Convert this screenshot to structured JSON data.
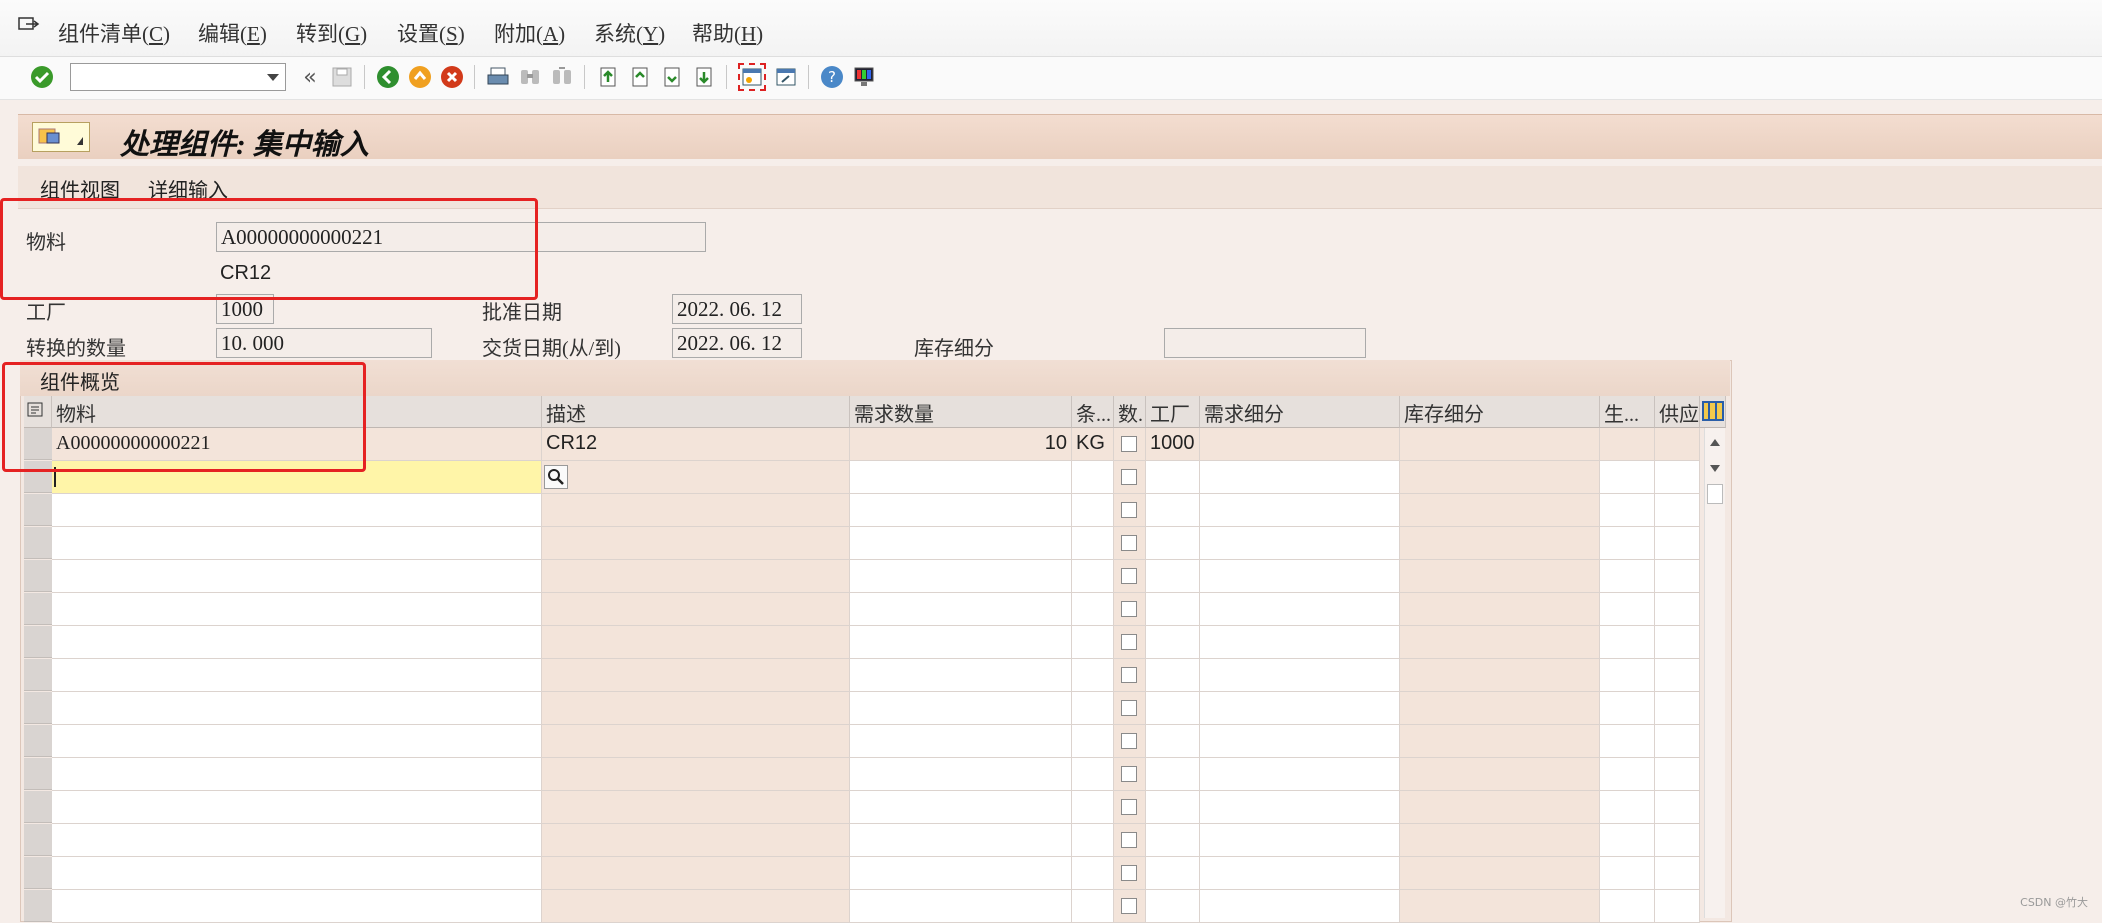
{
  "menu": [
    {
      "label": "组件清单(",
      "key": "C",
      "tail": ")"
    },
    {
      "label": "编辑(",
      "key": "E",
      "tail": ")"
    },
    {
      "label": "转到(",
      "key": "G",
      "tail": ")"
    },
    {
      "label": "设置(",
      "key": "S",
      "tail": ")"
    },
    {
      "label": "附加(",
      "key": "A",
      "tail": ")"
    },
    {
      "label": "系统(",
      "key": "Y",
      "tail": ")"
    },
    {
      "label": "帮助(",
      "key": "H",
      "tail": ")"
    }
  ],
  "toolbar": {
    "command_value": "",
    "back_glyph": "«"
  },
  "title": "处理组件: 集中输入",
  "app_toolbar": {
    "component_view": "组件视图",
    "detail_entry": "详细输入"
  },
  "header": {
    "material_label": "物料",
    "material_value": "A00000000000221",
    "material_desc": "CR12",
    "plant_label": "工厂",
    "plant_value": "1000",
    "approval_date_label": "批准日期",
    "approval_date_value": "2022. 06. 12",
    "qty_label": "转换的数量",
    "qty_value": "10. 000",
    "delivery_date_label": "交货日期(从/到)",
    "delivery_date_value": "2022. 06. 12",
    "stock_seg_label": "库存细分",
    "stock_seg_value": ""
  },
  "overview": {
    "title": "组件概览",
    "columns": [
      "物料",
      "描述",
      "需求数量",
      "条...",
      "数.",
      "工厂",
      "需求细分",
      "库存细分",
      "生...",
      "供应"
    ],
    "rows": [
      {
        "material": "A00000000000221",
        "desc": "CR12",
        "qty": "10",
        "unit": "KG",
        "plant": "1000"
      }
    ]
  },
  "watermark": "CSDN @竹大"
}
